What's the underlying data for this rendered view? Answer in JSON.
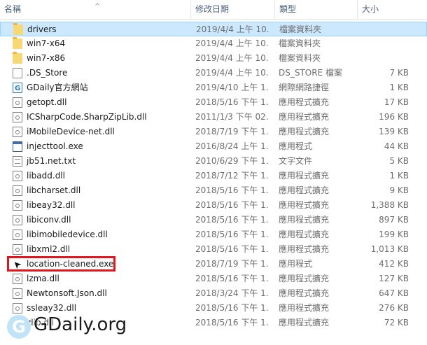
{
  "columns": {
    "name": "名稱",
    "date": "修改日期",
    "type": "類型",
    "size": "大小"
  },
  "sort_indicator": "^",
  "files": [
    {
      "name": "drivers",
      "date": "2019/4/4 上午 10...",
      "type": "檔案資料夾",
      "size": "",
      "icon": "folder-icon",
      "selected": true
    },
    {
      "name": "win7-x64",
      "date": "2019/4/4 上午 10...",
      "type": "檔案資料夾",
      "size": "",
      "icon": "folder-icon"
    },
    {
      "name": "win7-x86",
      "date": "2019/4/4 上午 10...",
      "type": "檔案資料夾",
      "size": "",
      "icon": "folder-icon"
    },
    {
      "name": ".DS_Store",
      "date": "2019/4/4 上午 10...",
      "type": "DS_STORE 檔案",
      "size": "7 KB",
      "icon": "file-icon"
    },
    {
      "name": "GDaily官方網站",
      "date": "2019/4/10 上午 1...",
      "type": "網際網路捷徑",
      "size": "1 KB",
      "icon": "url-shortcut-icon"
    },
    {
      "name": "getopt.dll",
      "date": "2018/5/16 下午 1...",
      "type": "應用程式擴充",
      "size": "17 KB",
      "icon": "dll-icon"
    },
    {
      "name": "ICSharpCode.SharpZipLib.dll",
      "date": "2011/1/3 下午 02...",
      "type": "應用程式擴充",
      "size": "196 KB",
      "icon": "dll-icon"
    },
    {
      "name": "iMobileDevice-net.dll",
      "date": "2018/7/19 下午 1...",
      "type": "應用程式擴充",
      "size": "139 KB",
      "icon": "dll-icon"
    },
    {
      "name": "injecttool.exe",
      "date": "2016/8/24 上午 1...",
      "type": "應用程式",
      "size": "44 KB",
      "icon": "exe-icon"
    },
    {
      "name": "jb51.net.txt",
      "date": "2010/6/29 下午 1...",
      "type": "文字文件",
      "size": "5 KB",
      "icon": "text-file-icon"
    },
    {
      "name": "libadd.dll",
      "date": "2018/7/12 下午 1...",
      "type": "應用程式擴充",
      "size": "1 KB",
      "icon": "dll-icon"
    },
    {
      "name": "libcharset.dll",
      "date": "2018/5/16 下午 1...",
      "type": "應用程式擴充",
      "size": "9 KB",
      "icon": "dll-icon"
    },
    {
      "name": "libeay32.dll",
      "date": "2018/5/16 下午 1...",
      "type": "應用程式擴充",
      "size": "1,388 KB",
      "icon": "dll-icon"
    },
    {
      "name": "libiconv.dll",
      "date": "2018/5/16 下午 1...",
      "type": "應用程式擴充",
      "size": "897 KB",
      "icon": "dll-icon"
    },
    {
      "name": "libimobiledevice.dll",
      "date": "2018/5/16 下午 1...",
      "type": "應用程式擴充",
      "size": "199 KB",
      "icon": "dll-icon"
    },
    {
      "name": "libxml2.dll",
      "date": "2018/5/16 下午 1...",
      "type": "應用程式擴充",
      "size": "1,013 KB",
      "icon": "dll-icon"
    },
    {
      "name": "location-cleaned.exe",
      "date": "2018/7/19 下午 1...",
      "type": "應用程式",
      "size": "412 KB",
      "icon": "location-arrow-icon",
      "highlighted": true
    },
    {
      "name": "lzma.dll",
      "date": "2018/5/16 下午 1...",
      "type": "應用程式擴充",
      "size": "127 KB",
      "icon": "dll-icon"
    },
    {
      "name": "Newtonsoft.Json.dll",
      "date": "2018/3/24 下午 1...",
      "type": "應用程式擴充",
      "size": "647 KB",
      "icon": "dll-icon"
    },
    {
      "name": "ssleay32.dll",
      "date": "2018/5/16 下午 1...",
      "type": "應用程式擴充",
      "size": "276 KB",
      "icon": "dll-icon"
    },
    {
      "name": "zlib.dll",
      "date": "2018/5/16 下午 1...",
      "type": "應用程式擴充",
      "size": "72 KB",
      "icon": "dll-icon"
    }
  ],
  "watermark": {
    "badge": "G",
    "text": "GDaily.org"
  },
  "colors": {
    "selection": "#cce8ff",
    "highlight_border": "#e0161b",
    "header_text": "#4c607a"
  }
}
